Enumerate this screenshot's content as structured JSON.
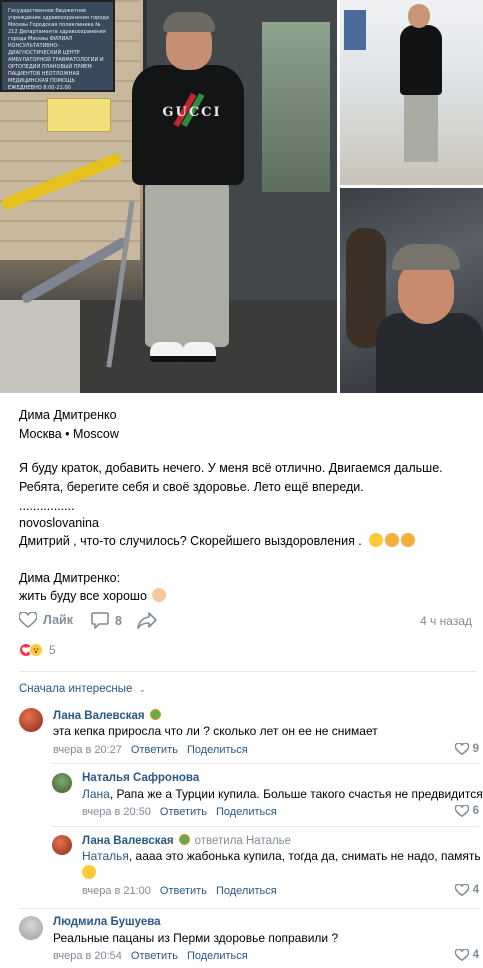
{
  "post": {
    "author": "Дима Дмитренко",
    "location": "Москва • Moscow",
    "body_line1": "Я буду краток, добавить нечего. У меня всё отлично. Двигаемся дальше.",
    "body_line2": "Ребята, берегите себя и своё здоровье. Лето ещё впереди.",
    "dots": "................",
    "quote_author": "novoslovanina",
    "quote_text": "Дмитрий , что-то случилось? Скорейшего выздоровления .",
    "reply_author": "Дима Дмитренко:",
    "reply_text": "жить буду все хорошо",
    "photo_logo": "GUCCI",
    "photo_sign_text": "Государственное бюджетное учреждение здравоохранения города Москвы Городская поликлиника № 212 Департамента здравоохранения города Москвы ФИЛИАЛ КОНСУЛЬТАТИВНО-ДИАГНОСТИЧЕСКИЙ ЦЕНТР АМБУЛАТОРНОЙ ТРАВМАТОЛОГИИ И ОРТОПЕДИИ ПЛАНОВЫЙ ПРИЕМ ПАЦИЕНТОВ НЕОТЛОЖНАЯ МЕДИЦИНСКАЯ ПОМОЩЬ ЕЖЕДНЕВНО 8:00-21:00"
  },
  "actions": {
    "like_label": "Лайк",
    "comments_count": "8",
    "time_ago": "4 ч назад"
  },
  "reactions": {
    "count": "5"
  },
  "comments_header": {
    "sort_label": "Сначала интересные"
  },
  "comments": [
    {
      "name": "Лана Валевская",
      "text": "эта кепка приросла что ли ? сколько лет он ее не снимает",
      "time": "вчера в 20:27",
      "reply_label": "Ответить",
      "share_label": "Поделиться",
      "likes": "9"
    },
    {
      "name": "Наталья Сафронова",
      "mention": "Лана",
      "text": ", Рапа же а Турции купила. Больше такого счастья не предвидится",
      "time": "вчера в 20:50",
      "reply_label": "Ответить",
      "share_label": "Поделиться",
      "likes": "6"
    },
    {
      "name": "Лана Валевская",
      "replied_to": "ответила Наталье",
      "mention": "Наталья",
      "text": ", аааа это жабонька купила, тогда да, снимать не надо, память",
      "time": "вчера в 21:00",
      "reply_label": "Ответить",
      "share_label": "Поделиться",
      "likes": "4"
    },
    {
      "name": "Людмила Бушуева",
      "text": "Реальные пацаны из Перми здоровье поправили ?",
      "time": "вчера в 20:54",
      "reply_label": "Ответить",
      "share_label": "Поделиться",
      "likes": "4"
    }
  ],
  "colors": {
    "link": "#2a5885",
    "muted": "#818c99",
    "heart": "#ff3347",
    "divider": "#e7e8ec"
  }
}
